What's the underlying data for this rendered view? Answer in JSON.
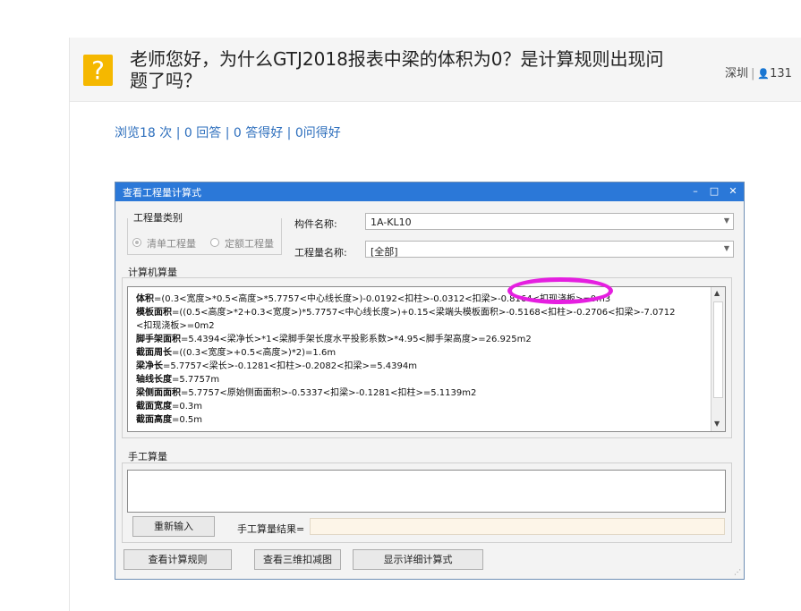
{
  "question": {
    "icon": "question-icon",
    "icon_glyph": "?",
    "title": "老师您好，为什么GTJ2018报表中梁的体积为0？是计算规则出现问题了吗？",
    "location": "深圳",
    "user_icon": "user-icon",
    "user_glyph": "👤",
    "user_count": "131"
  },
  "stats": {
    "text": "浏览18 次 | 0 回答 | 0 答得好 | 0问得好"
  },
  "dialog": {
    "title": "查看工程量计算式",
    "window_buttons": {
      "minimize": "–",
      "maximize": "□",
      "close": "✕"
    },
    "quantity_type": {
      "label": "工程量类别",
      "options": [
        "清单工程量",
        "定额工程量"
      ],
      "selected": "清单工程量"
    },
    "component_name": {
      "label": "构件名称:",
      "value": "1A-KL10"
    },
    "quantity_name": {
      "label": "工程量名称:",
      "value": "[全部]"
    },
    "computer_section": "计算机算量",
    "calc_lines": [
      {
        "name": "体积",
        "text": "=(0.3<宽度>*0.5<高度>*5.7757<中心线长度>)-0.0192<扣柱>-0.0312<扣梁>-0.8164<扣现浇板>=0m3"
      },
      {
        "name": "模板面积",
        "text": "=((0.5<高度>*2+0.3<宽度>)*5.7757<中心线长度>)+0.15<梁端头模板面积>-0.5168<扣柱>-0.2706<扣梁>-7.0712"
      },
      {
        "name": "",
        "text": "<扣现浇板>=0m2"
      },
      {
        "name": "脚手架面积",
        "text": "=5.4394<梁净长>*1<梁脚手架长度水平投影系数>*4.95<脚手架高度>=26.925m2"
      },
      {
        "name": "截面周长",
        "text": "=((0.3<宽度>+0.5<高度>)*2)=1.6m"
      },
      {
        "name": "梁净长",
        "text": "=5.7757<梁长>-0.1281<扣柱>-0.2082<扣梁>=5.4394m"
      },
      {
        "name": "轴线长度",
        "text": "=5.7757m"
      },
      {
        "name": "梁侧面面积",
        "text": "=5.7757<原始侧面面积>-0.5337<扣梁>-0.1281<扣柱>=5.1139m2"
      },
      {
        "name": "截面宽度",
        "text": "=0.3m"
      },
      {
        "name": "截面高度",
        "text": "=0.5m"
      }
    ],
    "manual_section": "手工算量",
    "manual_value": "",
    "reinput_button": "重新输入",
    "manual_result_label": "手工算量结果=",
    "manual_result_value": "",
    "view_rules_button": "查看计算规则",
    "view_3d_button": "查看三维扣减图",
    "show_detail_button": "显示详细计算式"
  },
  "colors": {
    "titlebar": "#2b78d8",
    "highlight_ellipse": "#e51fe0",
    "question_icon": "#f5b800",
    "link": "#2e6fbd"
  }
}
